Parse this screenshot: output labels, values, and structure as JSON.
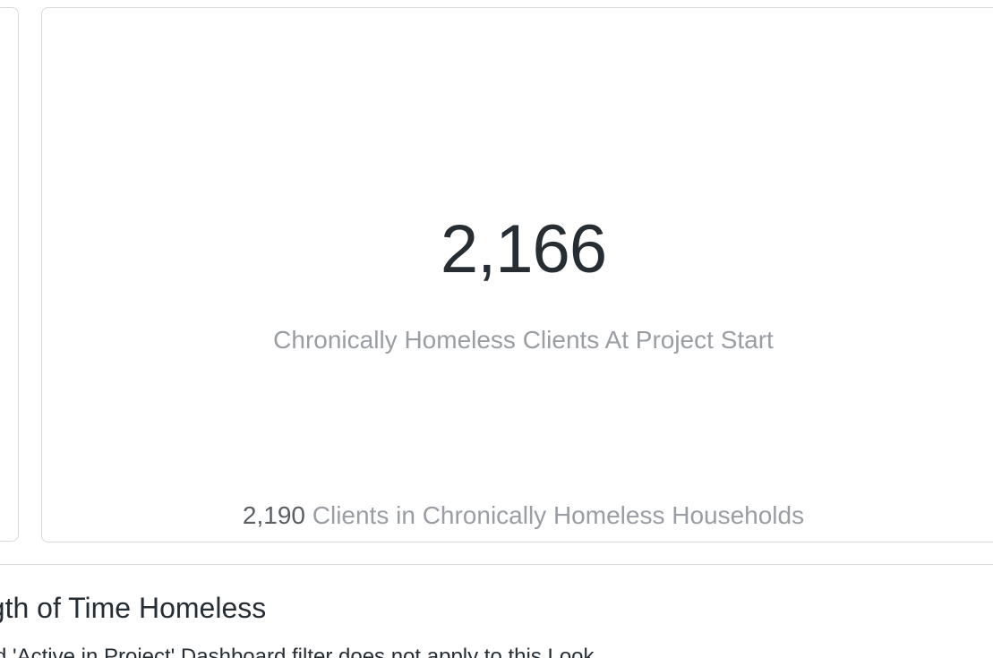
{
  "kpi_tile": {
    "value": "2,166",
    "label": "Chronically Homeless Clients At Project Start",
    "comparison_value": "2,190",
    "comparison_label": "Clients in Chronically Homeless Households"
  },
  "section": {
    "title": "ngth of Time Homeless",
    "note": "d 'Active in Project' Dashboard filter does not apply to this Look"
  }
}
